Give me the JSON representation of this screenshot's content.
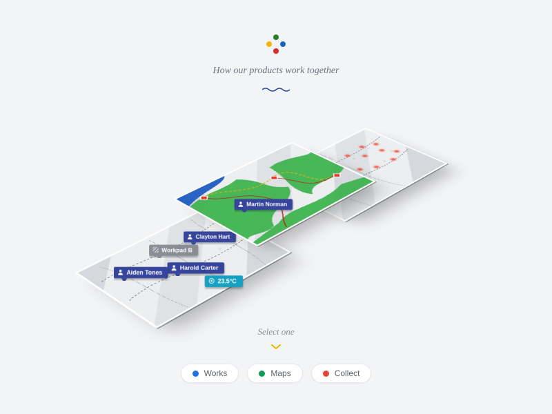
{
  "header": {
    "tagline": "How our products work together",
    "logo_colors": {
      "top": "#2c7a2c",
      "right": "#1565c0",
      "bottom": "#d32f2f",
      "left": "#f4b400"
    }
  },
  "cards": {
    "works": {
      "labels": {
        "aiden": "Aiden Tones",
        "workpad": "Workpad B",
        "clayton": "Clayton Hart",
        "harold": "Harold Carter",
        "temp": "23.5°C"
      }
    },
    "maps": {
      "labels": {
        "martin": "Martin Norman"
      }
    },
    "collect": {
      "heat_points": [
        [
          62,
          24
        ],
        [
          78,
          22
        ],
        [
          88,
          28
        ],
        [
          70,
          36
        ],
        [
          84,
          40
        ],
        [
          54,
          50
        ],
        [
          64,
          58
        ],
        [
          80,
          60
        ],
        [
          90,
          52
        ]
      ]
    }
  },
  "footer": {
    "prompt": "Select one",
    "options": [
      {
        "key": "works",
        "label": "Works",
        "color": "#1a73e8"
      },
      {
        "key": "maps",
        "label": "Maps",
        "color": "#0f9d58"
      },
      {
        "key": "collect",
        "label": "Collect",
        "color": "#ea4335"
      }
    ]
  }
}
